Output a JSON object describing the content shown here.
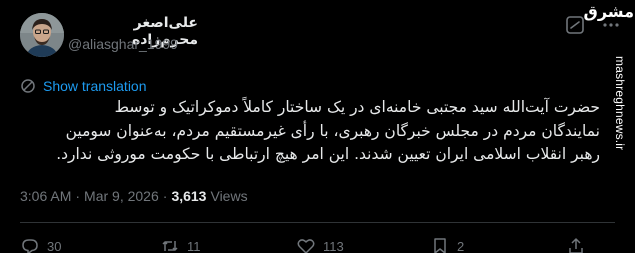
{
  "author": {
    "name": "علی‌اصغر محرم‌زاده",
    "handle": "@aliasghar_1999"
  },
  "watermark": {
    "logo_text": "مشرق",
    "site": "mashreghnews.ir"
  },
  "translate": {
    "label": "Show translation"
  },
  "body": {
    "lines": [
      "حضرت آیت‌الله سید مجتبی خامنه‌ای در یک ساختار کاملاً دموکراتیک و توسط",
      "نمایندگان مردم در مجلس خبرگان رهبری، با رأی غیرمستقیم مردم، به‌عنوان سومین",
      "رهبر انقلاب اسلامی ایران تعیین شدند. این امر هیچ ارتباطی با حکومت موروثی ندارد."
    ]
  },
  "meta": {
    "time": "3:06 AM",
    "separator": "·",
    "date": "Mar 9, 2026",
    "views_count": "3,613",
    "views_label": "Views"
  },
  "actions": {
    "replies": "30",
    "reposts": "11",
    "likes": "113",
    "bookmarks": "2"
  },
  "colors": {
    "background": "#000000",
    "text": "#e7e9ea",
    "secondary": "#71767b",
    "link": "#1d9bf0",
    "divider": "#2f3336"
  }
}
